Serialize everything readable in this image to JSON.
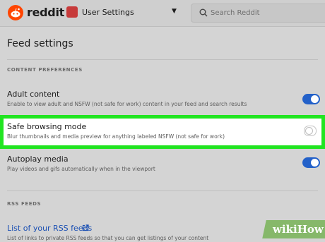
{
  "header": {
    "logo_text": "reddit",
    "context_label": "User Settings",
    "search_placeholder": "Search Reddit"
  },
  "page": {
    "title": "Feed settings"
  },
  "content_preferences": {
    "section_label": "CONTENT PREFERENCES",
    "rows": [
      {
        "title": "Adult content",
        "description": "Enable to view adult and NSFW (not safe for work) content in your feed and search results",
        "toggle": "on"
      },
      {
        "title": "Safe browsing mode",
        "description": "Blur thumbnails and media preview for anything labeled NSFW (not safe for work)",
        "toggle": "off"
      },
      {
        "title": "Autoplay media",
        "description": "Play videos and gifs automatically when in the viewport",
        "toggle": "on"
      }
    ]
  },
  "rss_feeds": {
    "section_label": "RSS FEEDS",
    "link_title": "List of your RSS feeds",
    "link_description": "List of links to private RSS feeds so that you can get listings of your content"
  },
  "watermark": {
    "text": "wikiHow"
  },
  "colors": {
    "accent": "#2361c9",
    "brand": "#ff4500",
    "highlight": "#21e521",
    "link": "#1a4fb3"
  },
  "icons": {
    "logo": "reddit-logo-icon",
    "search": "search-icon",
    "caret": "chevron-down-icon",
    "external": "external-link-icon"
  }
}
